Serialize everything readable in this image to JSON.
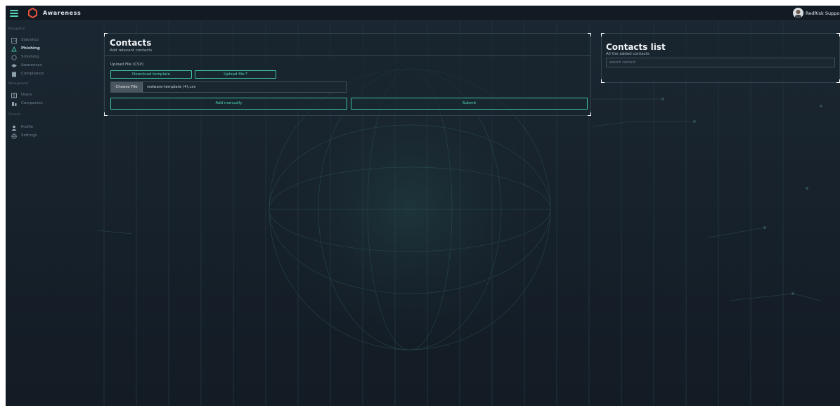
{
  "app": {
    "title": "Awareness",
    "user_name": "RedRisk Support"
  },
  "sidebar": {
    "sections": [
      {
        "label": "Navigation"
      },
      {
        "label": "Management"
      },
      {
        "label": "General"
      }
    ],
    "items": [
      {
        "label": "Statistics",
        "icon": "chart-icon",
        "active": false
      },
      {
        "label": "Phishing",
        "icon": "fish-icon",
        "active": true
      },
      {
        "label": "Smishing",
        "icon": "chat-icon",
        "active": false
      },
      {
        "label": "Awareness",
        "icon": "graduation-cap-icon",
        "active": false
      },
      {
        "label": "Compliance",
        "icon": "document-icon",
        "active": false
      },
      {
        "label": "Users",
        "icon": "users-icon",
        "active": false
      },
      {
        "label": "Companies",
        "icon": "building-icon",
        "active": false
      },
      {
        "label": "Profile",
        "icon": "user-icon",
        "active": false
      },
      {
        "label": "Settings",
        "icon": "gear-icon",
        "active": false
      }
    ]
  },
  "contacts": {
    "title": "Contacts",
    "subtitle": "Add relevant contacts",
    "upload_label": "Upload File (CSV)",
    "download_template": "Download template",
    "upload_file": "Upload file ⤒",
    "choose_file": "Choose File",
    "file_name": "redware-template (4).csv",
    "add_manually": "Add manually",
    "submit": "Submit"
  },
  "contacts_list": {
    "title": "Contacts list",
    "subtitle": "All the added contacts",
    "search_placeholder": "search contact"
  },
  "colors": {
    "accent": "#3fbfa1",
    "background": "#17222c",
    "topbar": "#121b24"
  }
}
